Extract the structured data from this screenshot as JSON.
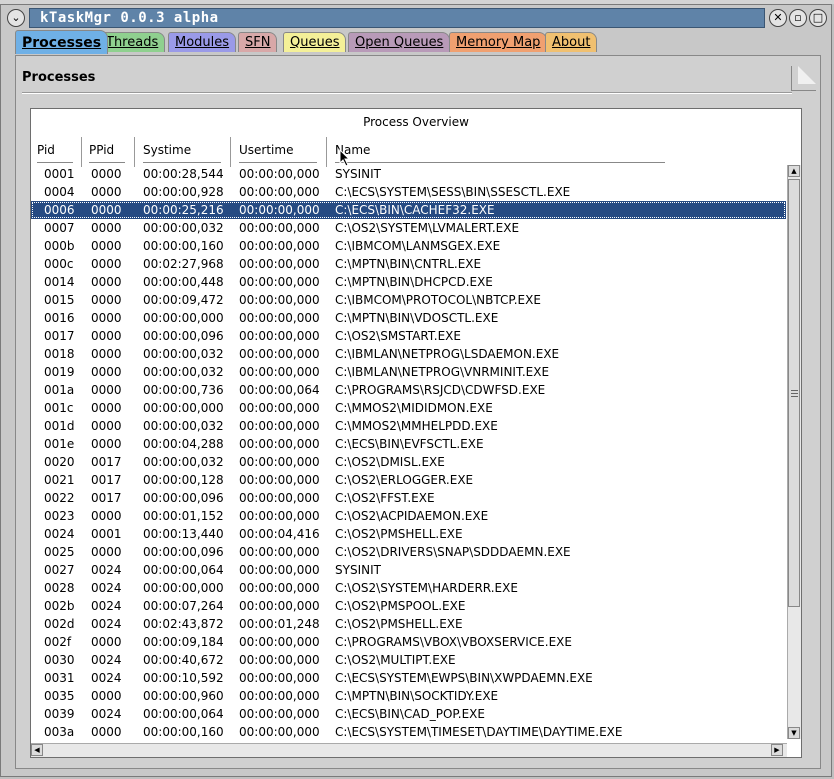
{
  "window": {
    "title": "kTaskMgr 0.0.3 alpha",
    "title_color": "#5f83a8"
  },
  "tabs": [
    {
      "label": "Processes",
      "color": "#6fb0e6"
    },
    {
      "label": "Threads",
      "color": "#8fd08f"
    },
    {
      "label": "Modules",
      "color": "#9a9ae8"
    },
    {
      "label": "SFN",
      "color": "#d8a8a8"
    },
    {
      "label": "Queues",
      "color": "#f4f098"
    },
    {
      "label": "Open Queues",
      "color": "#b89ab8"
    },
    {
      "label": "Memory Map",
      "color": "#f0a070"
    },
    {
      "label": "About",
      "color": "#f0c070"
    }
  ],
  "panel": {
    "title": "Processes"
  },
  "list": {
    "title": "Process Overview",
    "columns": {
      "pid": "Pid",
      "ppid": "PPid",
      "systime": "Systime",
      "usertime": "Usertime",
      "name": "Name"
    },
    "selected_pid": "0006",
    "rows": [
      {
        "pid": "0001",
        "ppid": "0000",
        "systime": "00:00:28,544",
        "usertime": "00:00:00,000",
        "name": "SYSINIT"
      },
      {
        "pid": "0004",
        "ppid": "0000",
        "systime": "00:00:00,928",
        "usertime": "00:00:00,000",
        "name": "C:\\ECS\\SYSTEM\\SESS\\BIN\\SSESCTL.EXE"
      },
      {
        "pid": "0006",
        "ppid": "0000",
        "systime": "00:00:25,216",
        "usertime": "00:00:00,000",
        "name": "C:\\ECS\\BIN\\CACHEF32.EXE"
      },
      {
        "pid": "0007",
        "ppid": "0000",
        "systime": "00:00:00,032",
        "usertime": "00:00:00,000",
        "name": "C:\\OS2\\SYSTEM\\LVMALERT.EXE"
      },
      {
        "pid": "000b",
        "ppid": "0000",
        "systime": "00:00:00,160",
        "usertime": "00:00:00,000",
        "name": "C:\\IBMCOM\\LANMSGEX.EXE"
      },
      {
        "pid": "000c",
        "ppid": "0000",
        "systime": "00:02:27,968",
        "usertime": "00:00:00,000",
        "name": "C:\\MPTN\\BIN\\CNTRL.EXE"
      },
      {
        "pid": "0014",
        "ppid": "0000",
        "systime": "00:00:00,448",
        "usertime": "00:00:00,000",
        "name": "C:\\MPTN\\BIN\\DHCPCD.EXE"
      },
      {
        "pid": "0015",
        "ppid": "0000",
        "systime": "00:00:09,472",
        "usertime": "00:00:00,000",
        "name": "C:\\IBMCOM\\PROTOCOL\\NBTCP.EXE"
      },
      {
        "pid": "0016",
        "ppid": "0000",
        "systime": "00:00:00,000",
        "usertime": "00:00:00,000",
        "name": "C:\\MPTN\\BIN\\VDOSCTL.EXE"
      },
      {
        "pid": "0017",
        "ppid": "0000",
        "systime": "00:00:00,096",
        "usertime": "00:00:00,000",
        "name": "C:\\OS2\\SMSTART.EXE"
      },
      {
        "pid": "0018",
        "ppid": "0000",
        "systime": "00:00:00,032",
        "usertime": "00:00:00,000",
        "name": "C:\\IBMLAN\\NETPROG\\LSDAEMON.EXE"
      },
      {
        "pid": "0019",
        "ppid": "0000",
        "systime": "00:00:00,032",
        "usertime": "00:00:00,000",
        "name": "C:\\IBMLAN\\NETPROG\\VNRMINIT.EXE"
      },
      {
        "pid": "001a",
        "ppid": "0000",
        "systime": "00:00:00,736",
        "usertime": "00:00:00,064",
        "name": "C:\\PROGRAMS\\RSJCD\\CDWFSD.EXE"
      },
      {
        "pid": "001c",
        "ppid": "0000",
        "systime": "00:00:00,000",
        "usertime": "00:00:00,000",
        "name": "C:\\MMOS2\\MIDIDMON.EXE"
      },
      {
        "pid": "001d",
        "ppid": "0000",
        "systime": "00:00:00,032",
        "usertime": "00:00:00,000",
        "name": "C:\\MMOS2\\MMHELPDD.EXE"
      },
      {
        "pid": "001e",
        "ppid": "0000",
        "systime": "00:00:04,288",
        "usertime": "00:00:00,000",
        "name": "C:\\ECS\\BIN\\EVFSCTL.EXE"
      },
      {
        "pid": "0020",
        "ppid": "0017",
        "systime": "00:00:00,032",
        "usertime": "00:00:00,000",
        "name": "C:\\OS2\\DMISL.EXE"
      },
      {
        "pid": "0021",
        "ppid": "0017",
        "systime": "00:00:00,128",
        "usertime": "00:00:00,000",
        "name": "C:\\OS2\\ERLOGGER.EXE"
      },
      {
        "pid": "0022",
        "ppid": "0017",
        "systime": "00:00:00,096",
        "usertime": "00:00:00,000",
        "name": "C:\\OS2\\FFST.EXE"
      },
      {
        "pid": "0023",
        "ppid": "0000",
        "systime": "00:00:01,152",
        "usertime": "00:00:00,000",
        "name": "C:\\OS2\\ACPIDAEMON.EXE"
      },
      {
        "pid": "0024",
        "ppid": "0001",
        "systime": "00:00:13,440",
        "usertime": "00:00:04,416",
        "name": "C:\\OS2\\PMSHELL.EXE"
      },
      {
        "pid": "0025",
        "ppid": "0000",
        "systime": "00:00:00,096",
        "usertime": "00:00:00,000",
        "name": "C:\\OS2\\DRIVERS\\SNAP\\SDDDAEMN.EXE"
      },
      {
        "pid": "0027",
        "ppid": "0024",
        "systime": "00:00:00,064",
        "usertime": "00:00:00,000",
        "name": "SYSINIT"
      },
      {
        "pid": "0028",
        "ppid": "0024",
        "systime": "00:00:00,000",
        "usertime": "00:00:00,000",
        "name": "C:\\OS2\\SYSTEM\\HARDERR.EXE"
      },
      {
        "pid": "002b",
        "ppid": "0024",
        "systime": "00:00:07,264",
        "usertime": "00:00:00,000",
        "name": "C:\\OS2\\PMSPOOL.EXE"
      },
      {
        "pid": "002d",
        "ppid": "0024",
        "systime": "00:02:43,872",
        "usertime": "00:00:01,248",
        "name": "C:\\OS2\\PMSHELL.EXE"
      },
      {
        "pid": "002f",
        "ppid": "0000",
        "systime": "00:00:09,184",
        "usertime": "00:00:00,000",
        "name": "C:\\PROGRAMS\\VBOX\\VBOXSERVICE.EXE"
      },
      {
        "pid": "0030",
        "ppid": "0024",
        "systime": "00:00:40,672",
        "usertime": "00:00:00,000",
        "name": "C:\\OS2\\MULTIPT.EXE"
      },
      {
        "pid": "0031",
        "ppid": "0024",
        "systime": "00:00:10,592",
        "usertime": "00:00:00,000",
        "name": "C:\\ECS\\SYSTEM\\EWPS\\BIN\\XWPDAEMN.EXE"
      },
      {
        "pid": "0035",
        "ppid": "0000",
        "systime": "00:00:00,960",
        "usertime": "00:00:00,000",
        "name": "C:\\MPTN\\BIN\\SOCKTIDY.EXE"
      },
      {
        "pid": "0039",
        "ppid": "0024",
        "systime": "00:00:00,064",
        "usertime": "00:00:00,000",
        "name": "C:\\ECS\\BIN\\CAD_POP.EXE"
      },
      {
        "pid": "003a",
        "ppid": "0000",
        "systime": "00:00:00,160",
        "usertime": "00:00:00,000",
        "name": "C:\\ECS\\SYSTEM\\TIMESET\\DAYTIME\\DAYTIME.EXE"
      }
    ]
  }
}
